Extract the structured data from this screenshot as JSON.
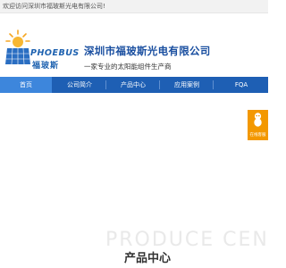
{
  "topbar": {
    "welcome_text": "欢迎访问深圳市福玻斯光电有限公司!"
  },
  "logo": {
    "text_en": "PHOEBUS",
    "text_cn": "福玻斯"
  },
  "header": {
    "company_name": "深圳市福玻斯光电有限公司",
    "slogan": "一家专业的太阳能组件生产商"
  },
  "nav": {
    "items": [
      {
        "label": "首页",
        "active": true
      },
      {
        "label": "公司简介"
      },
      {
        "label": "产品中心"
      },
      {
        "label": "应用案例"
      },
      {
        "label": "FQA"
      }
    ]
  },
  "float_service": {
    "label": "在线客服",
    "icon": "qq-penguin-icon"
  },
  "section": {
    "watermark": "PRODUCE CENTE",
    "title": "产品中心"
  },
  "colors": {
    "nav": "#1e5fb4",
    "nav_active": "#3d86dc",
    "accent": "#f39800",
    "brand": "#1a4fa0"
  }
}
